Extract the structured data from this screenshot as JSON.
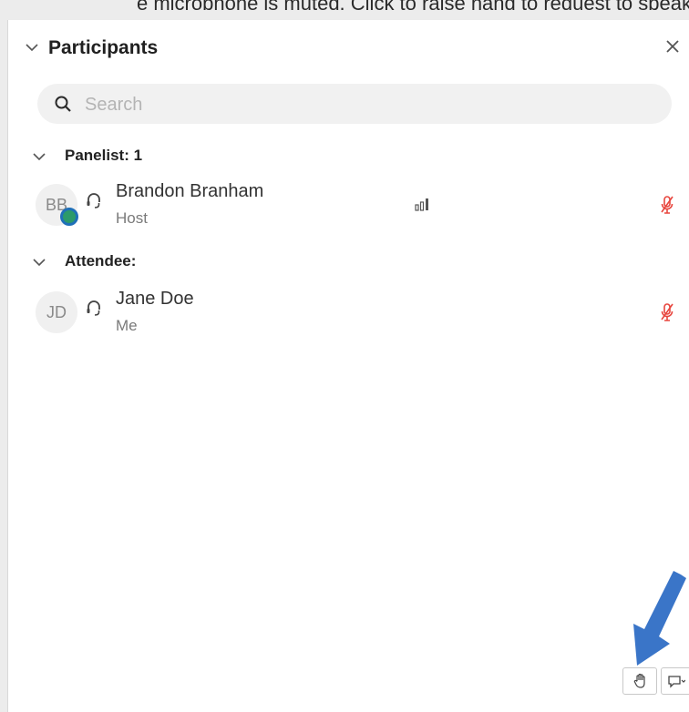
{
  "window": {
    "top_text": "e microphone is muted. Click to raise hand to request to speak"
  },
  "panel": {
    "title": "Participants"
  },
  "search": {
    "placeholder": "Search"
  },
  "sections": [
    {
      "label": "Panelist: 1"
    },
    {
      "label": "Attendee:"
    }
  ],
  "participants": [
    {
      "initials": "BB",
      "name": "Brandon Branham",
      "role": "Host",
      "audio": "headset-icon",
      "signal": "signal-bars-icon",
      "mic": "muted-mic-icon"
    },
    {
      "initials": "JD",
      "name": "Jane Doe",
      "role": "Me",
      "audio": "headset-icon",
      "mic": "muted-mic-icon"
    }
  ],
  "colors": {
    "muted_mic": "#e8463e",
    "arrow": "#3a75c8",
    "presence_ring": "#1f70b8",
    "presence_fill": "#2c9a6a"
  },
  "toolbar": {
    "raise_hand_icon": "raise-hand-icon",
    "reactions_icon": "reactions-icon"
  }
}
